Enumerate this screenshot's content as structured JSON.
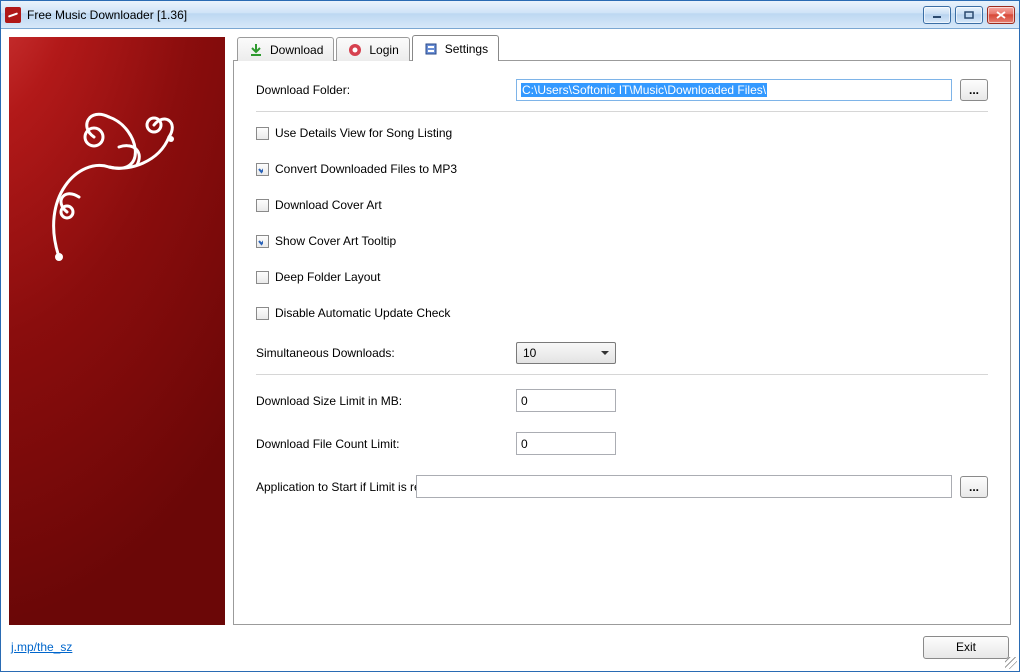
{
  "window": {
    "title": "Free Music Downloader [1.36]"
  },
  "tabs": {
    "download": "Download",
    "login": "Login",
    "settings": "Settings"
  },
  "settings": {
    "download_folder_label": "Download Folder:",
    "download_folder_value": "C:\\Users\\Softonic IT\\Music\\Downloaded Files\\",
    "browse": "...",
    "use_details_view": {
      "label": "Use Details View for Song Listing",
      "checked": false
    },
    "convert_mp3": {
      "label": "Convert Downloaded Files to MP3",
      "checked": true
    },
    "download_cover_art": {
      "label": "Download Cover Art",
      "checked": false
    },
    "show_cover_tooltip": {
      "label": "Show Cover Art Tooltip",
      "checked": true
    },
    "deep_folder": {
      "label": "Deep Folder Layout",
      "checked": false
    },
    "disable_update": {
      "label": "Disable Automatic Update Check",
      "checked": false
    },
    "simultaneous_label": "Simultaneous Downloads:",
    "simultaneous_value": "10",
    "size_limit_label": "Download Size Limit in MB:",
    "size_limit_value": "0",
    "count_limit_label": "Download File Count Limit:",
    "count_limit_value": "0",
    "app_limit_label": "Application to Start if Limit is reached:",
    "app_limit_value": ""
  },
  "footer": {
    "link": "j.mp/the_sz",
    "exit": "Exit"
  }
}
